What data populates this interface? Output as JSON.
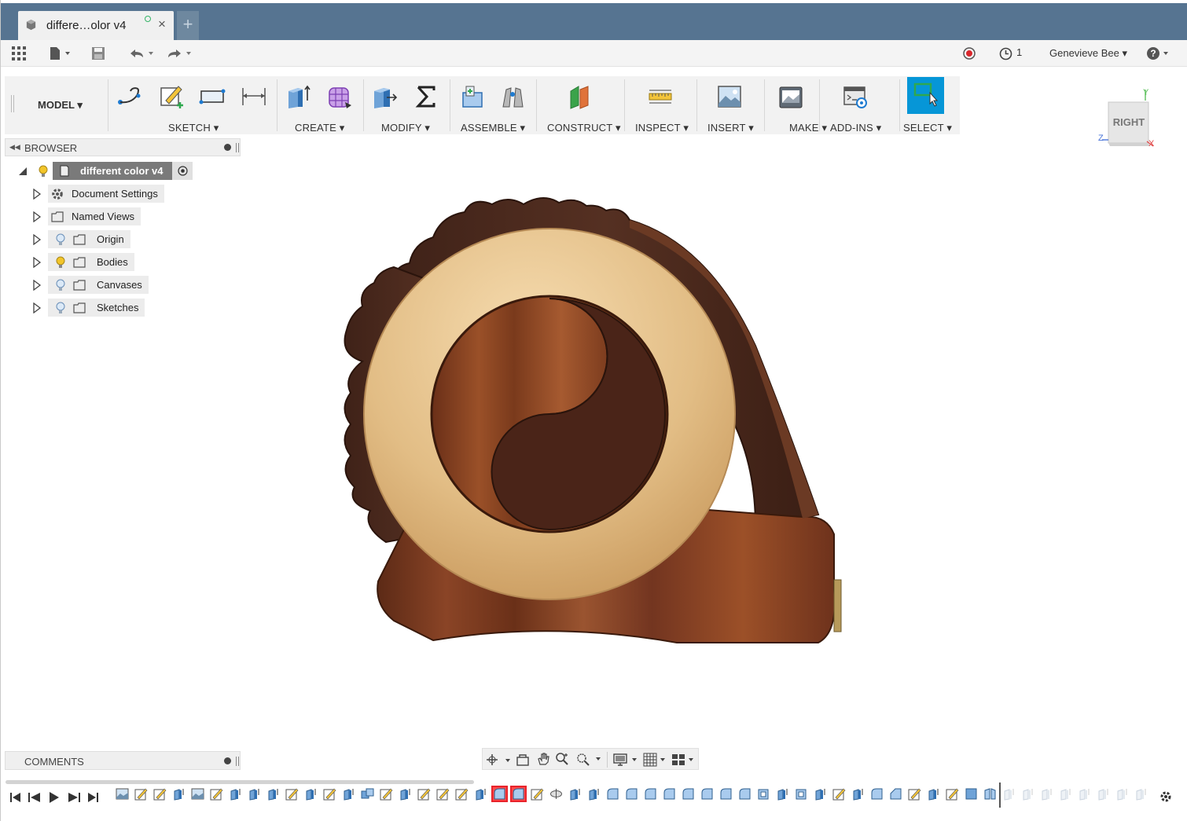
{
  "tab": {
    "title": "differe…olor v4",
    "new_tab": "+",
    "close": "×"
  },
  "quick_access": {
    "job_count": "1",
    "user": "Genevieve Bee",
    "user_caret": "▾",
    "help": "?"
  },
  "workspace": {
    "label": "MODEL ▾"
  },
  "toolbar_groups": [
    {
      "label": "SKETCH ▾"
    },
    {
      "label": "CREATE ▾"
    },
    {
      "label": "MODIFY ▾"
    },
    {
      "label": "ASSEMBLE ▾"
    },
    {
      "label": "CONSTRUCT ▾"
    },
    {
      "label": "INSPECT ▾"
    },
    {
      "label": "INSERT ▾"
    },
    {
      "label": "MAKE ▾"
    },
    {
      "label": "ADD-INS ▾"
    },
    {
      "label": "SELECT ▾"
    }
  ],
  "viewcube": {
    "face": "RIGHT",
    "axis_y": "Y",
    "axis_z": "Z",
    "axis_x": "X"
  },
  "browser": {
    "title": "BROWSER",
    "root": "different color v4",
    "items": [
      {
        "label": "Document Settings"
      },
      {
        "label": "Named Views"
      },
      {
        "label": "Origin"
      },
      {
        "label": "Bodies"
      },
      {
        "label": "Canvases"
      },
      {
        "label": "Sketches"
      }
    ]
  },
  "comments": {
    "title": "COMMENTS"
  },
  "colors": {
    "title_bar": "#567491",
    "accent": "#0696d7",
    "wood_dark": "#4a2a1c",
    "wood_mid": "#7a3f22",
    "ring": "#e3c08c"
  }
}
